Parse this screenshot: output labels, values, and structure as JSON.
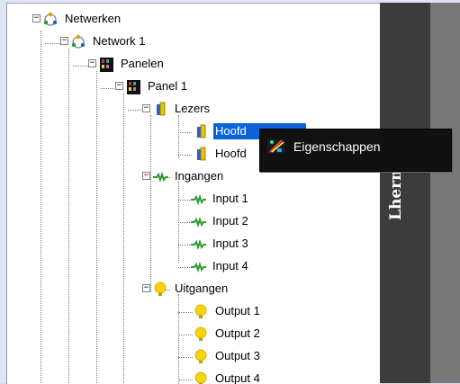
{
  "tree": {
    "nodes": [
      {
        "label": "Netwerken",
        "icon": "network-icon"
      },
      {
        "label": "Network 1",
        "icon": "network-icon"
      },
      {
        "label": "Panelen",
        "icon": "panel-icon"
      },
      {
        "label": "Panel 1",
        "icon": "panel-icon"
      },
      {
        "label": "Lezers",
        "icon": "reader-group-icon"
      },
      {
        "label": "Hoofd",
        "icon": "reader-icon"
      },
      {
        "label": "Hoofd",
        "icon": "reader-icon"
      },
      {
        "label": "Ingangen",
        "icon": "input-group-icon"
      },
      {
        "label": "Input 1",
        "icon": "input-icon"
      },
      {
        "label": "Input 2",
        "icon": "input-icon"
      },
      {
        "label": "Input 3",
        "icon": "input-icon"
      },
      {
        "label": "Input 4",
        "icon": "input-icon"
      },
      {
        "label": "Uitgangen",
        "icon": "lightbulb-icon"
      },
      {
        "label": "Output 1",
        "icon": "lightbulb-icon"
      },
      {
        "label": "Output 2",
        "icon": "lightbulb-icon"
      },
      {
        "label": "Output 3",
        "icon": "lightbulb-icon"
      },
      {
        "label": "Output 4",
        "icon": "lightbulb-icon"
      }
    ]
  },
  "context_menu": {
    "item": "Eigenschappen",
    "icon": "properties-icon"
  },
  "side_panel": {
    "vertical_text": "Lherm"
  },
  "colors": {
    "selection": "#0a64d8",
    "menu_bg": "#111111",
    "dark_panel": "#3c3c3c",
    "gray_panel": "#777777"
  }
}
